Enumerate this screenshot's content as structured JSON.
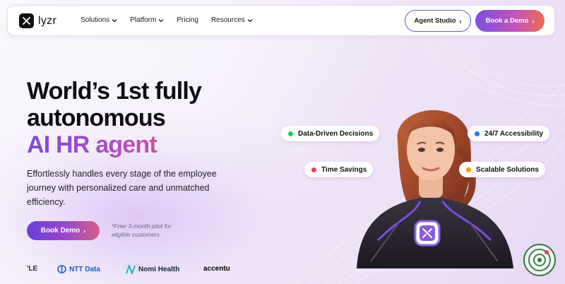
{
  "nav": {
    "logo_text": "lyzr",
    "links": [
      {
        "label": "Solutions",
        "has_dropdown": true
      },
      {
        "label": "Platform",
        "has_dropdown": true
      },
      {
        "label": "Pricing",
        "has_dropdown": false
      },
      {
        "label": "Resources",
        "has_dropdown": true
      }
    ],
    "agent_studio_label": "Agent Studio",
    "book_demo_label": "Book a Demo"
  },
  "hero": {
    "title_line1": "World’s 1st fully",
    "title_line2": "autonomous",
    "title_line3": "AI HR agent",
    "subtitle": "Effortlessly handles every stage of the employee journey with personalized care and unmatched efficiency.",
    "cta_label": "Book Demo",
    "note": "*Free 3-month pilot for eligible customers"
  },
  "logos": [
    {
      "name": "'LE"
    },
    {
      "name": "NTT Data"
    },
    {
      "name": "Nomi Health"
    },
    {
      "name": "accentu"
    }
  ],
  "features": [
    {
      "label": "Data-Driven Decisions",
      "color": "#22c55e"
    },
    {
      "label": "24/7 Accessibility",
      "color": "#1d7bf0"
    },
    {
      "label": "Time Savings",
      "color": "#ef3b5c"
    },
    {
      "label": "Scalable Solutions",
      "color": "#f59e0b"
    }
  ],
  "colors": {
    "accent_purple": "#7b4fe0",
    "accent_orange": "#f06a52"
  }
}
